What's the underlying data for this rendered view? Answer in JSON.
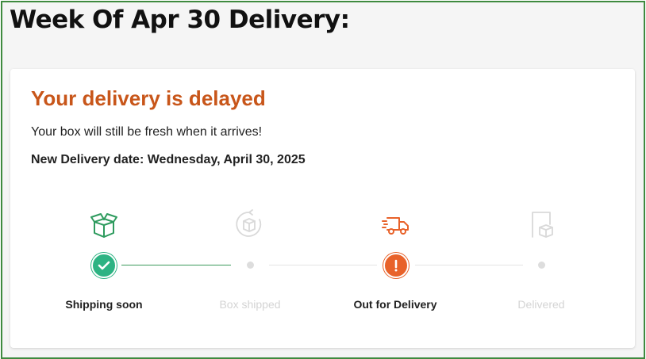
{
  "page": {
    "title": "Week Of Apr 30 Delivery:"
  },
  "delivery": {
    "status_title": "Your delivery is delayed",
    "message": "Your box will still be fresh when it arrives!",
    "new_date_label": "New Delivery date: Wednesday, April 30, 2025"
  },
  "tracker": {
    "steps": [
      {
        "label": "Shipping soon",
        "state": "complete",
        "icon": "open-box-icon"
      },
      {
        "label": "Box shipped",
        "state": "pending",
        "icon": "box-shipped-icon"
      },
      {
        "label": "Out for Delivery",
        "state": "alert",
        "icon": "delivery-truck-icon"
      },
      {
        "label": "Delivered",
        "state": "pending",
        "icon": "box-at-door-icon"
      }
    ]
  },
  "colors": {
    "accent_orange": "#c8561a",
    "alert_orange": "#e8622a",
    "complete_green": "#2db383",
    "progress_line_green": "#3a9a5c",
    "frame_green": "#3f8a3f",
    "inactive_gray": "#d4d4d4"
  }
}
